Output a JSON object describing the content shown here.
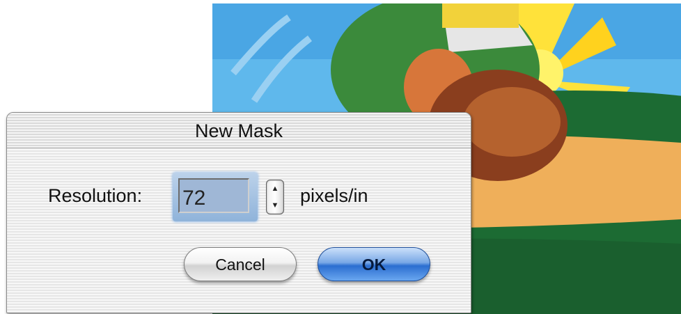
{
  "dialog": {
    "title": "New Mask",
    "resolution_label": "Resolution:",
    "resolution_value": "72",
    "unit_label": "pixels/in",
    "cancel_label": "Cancel",
    "ok_label": "OK"
  },
  "icons": {
    "stepper_up": "▲",
    "stepper_down": "▼"
  },
  "colors": {
    "sky": "#5fb8ec",
    "grass": "#1c6b33",
    "path": "#efaf5a",
    "ok_button": "#2b6ed0"
  }
}
